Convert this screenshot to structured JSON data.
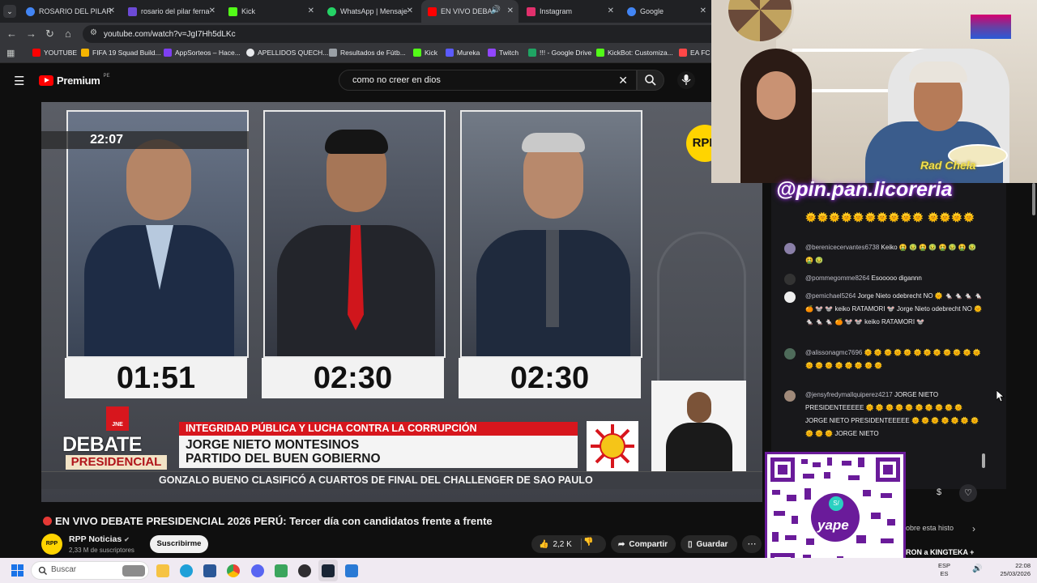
{
  "browser": {
    "tabs": [
      {
        "label": "ROSARIO DEL PILAR",
        "color": "#4285f4"
      },
      {
        "label": "rosario del pilar ferna",
        "color": "#6c4ad6"
      },
      {
        "label": "Kick",
        "color": "#53fc18"
      },
      {
        "label": "WhatsApp | Mensaje",
        "color": "#25d366"
      },
      {
        "label": "EN VIVO DEBA",
        "color": "#ff0000"
      },
      {
        "label": "Instagram",
        "color": "#e1306c"
      },
      {
        "label": "Google",
        "color": "#4285f4"
      }
    ],
    "url": "youtube.com/watch?v=JgI7Hh5dLKc",
    "bookmarks": [
      {
        "label": "YOUTUBE",
        "color": "#ff0000"
      },
      {
        "label": "FIFA 19 Squad Build...",
        "color": "#f5b400"
      },
      {
        "label": "AppSorteos – Hace...",
        "color": "#7e3ff2"
      },
      {
        "label": "APELLIDOS QUECH...",
        "color": "#e8eaed"
      },
      {
        "label": "Resultados de Fútb...",
        "color": "#9aa0a6"
      },
      {
        "label": "Kick",
        "color": "#53fc18"
      },
      {
        "label": "Mureka",
        "color": "#5b5bff"
      },
      {
        "label": "Twitch",
        "color": "#9146ff"
      },
      {
        "label": "!!! - Google Drive",
        "color": "#1fa463"
      },
      {
        "label": "KickBot: Customiza...",
        "color": "#53fc18"
      },
      {
        "label": "EA FC",
        "color": "#ff4747"
      }
    ]
  },
  "youtube": {
    "logo": "Premium",
    "country": "PE",
    "search_query": "como no creer en dios",
    "video": {
      "clock": "22:07",
      "timers": [
        "01:51",
        "02:30",
        "02:30"
      ],
      "lower_third_topic": "INTEGRIDAD PÚBLICA Y LUCHA CONTRA LA CORRUPCIÓN",
      "candidate_name": "JORGE NIETO MONTESINOS",
      "candidate_party": "PARTIDO DEL BUEN GOBIERNO",
      "debate_top": "DEBATE",
      "debate_bottom": "PRESIDENCIAL",
      "jne": "JNE",
      "ticker": "GONZALO BUENO CLASIFICÓ A CUARTOS DE FINAL DEL CHALLENGER DE SAO PAULO",
      "corner_logo": "RPP"
    },
    "title": "EN VIVO DEBATE PRESIDENCIAL 2026 PERÚ: Tercer día con candidatos frente a frente",
    "channel": {
      "name": "RPP Noticias",
      "subscribers": "2,33 M de suscriptores",
      "avatar_text": "RPP"
    },
    "subscribe_label": "Suscribirme",
    "likes": "2,2 K",
    "share_label": "Compartir",
    "save_label": "Guardar"
  },
  "stream": {
    "banner": "@pin.pan.licoreria",
    "streamer_tag": "Rad Chela",
    "chat": [
      {
        "user": "@berenicecervantes6738",
        "message": "Keiko 🤮 🤢 🤮 🤢 🤮 🤢 🤮 🤢 🤮 🤢"
      },
      {
        "user": "@pommegomme8264",
        "message": "Esooooo digannn"
      },
      {
        "user": "@pemichael5264",
        "message": "Jorge Nieto odebrecht NO 🌞 🐁 🐁 🐁 🐁 🍊 🐭 🐭 keiko RATAMORI 🐭 Jorge Nieto odebrecht NO 🌞 🐁 🐁 🐁 🍊 🐭 🐭 keiko RATAMORI 🐭"
      },
      {
        "user": "@alissonagmc7696",
        "message": "🌞 🌞 🌞 🌞 🌞 🌞 🌞 🌞 🌞 🌞 🌞 🌞 🌞 🌞 🌞 🌞 🌞 🌞 🌞 🌞"
      },
      {
        "user": "@jensyfredymallquiperez4217",
        "message": "JORGE NIETO PRESIDENTEEEEE 🌞 🌞 🌞 🌞 🌞 🌞 🌞 🌞 🌞 🌞 JORGE NIETO PRESIDENTEEEEE 🌞 🌞 🌞 🌞 🌞 🌞 🌞 🌞 🌞 🌞 JORGE NIETO"
      }
    ],
    "qr_label": "yape",
    "snippet_1": "obre esta histo",
    "snippet_2": "RON a KINGTEKA +"
  },
  "taskbar": {
    "search_placeholder": "Buscar",
    "lang": "ESP",
    "region": "ES",
    "time": "22:08",
    "date": "25/03/2026"
  }
}
